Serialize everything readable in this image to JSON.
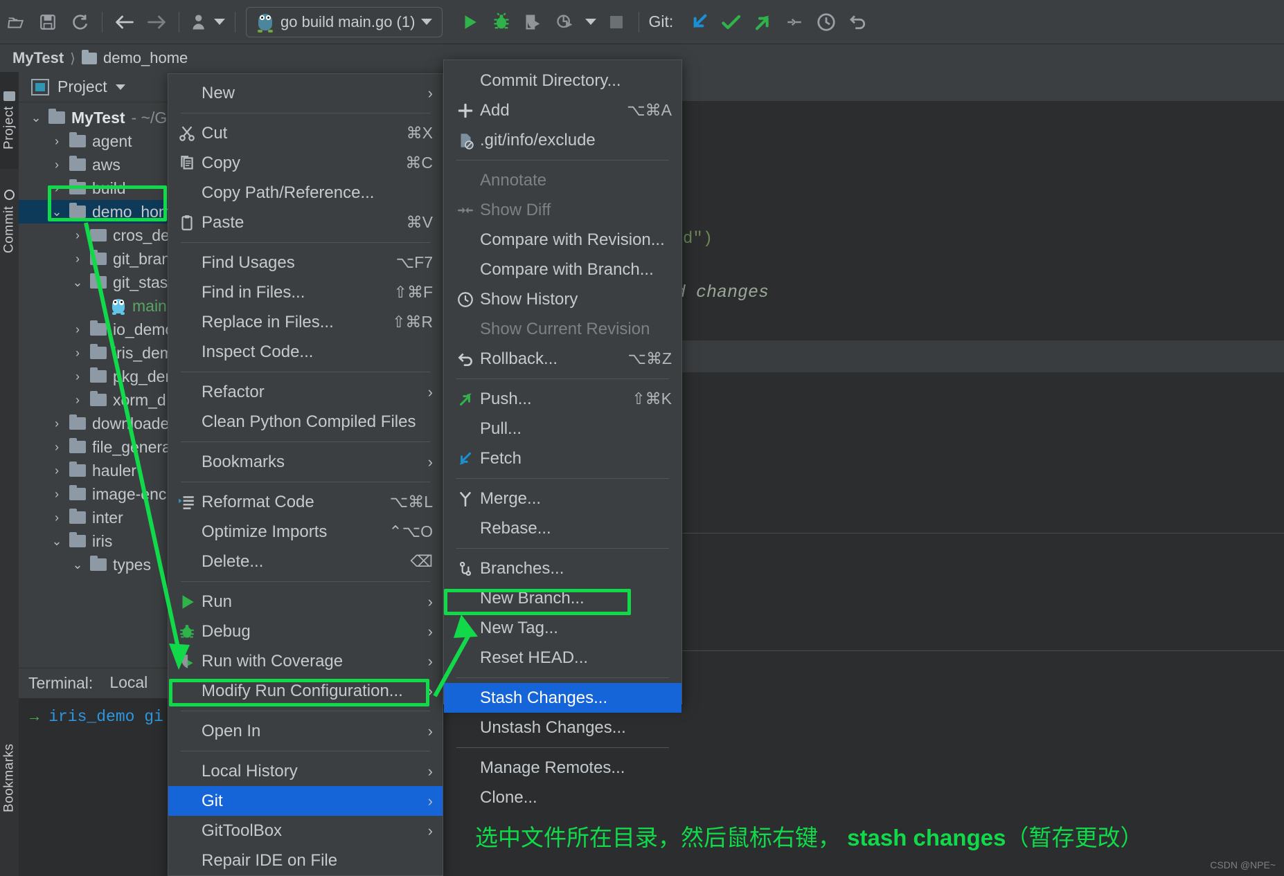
{
  "toolbar": {
    "icons": [
      "open-folder-icon",
      "save-icon",
      "sync-icon",
      "back-arrow-icon",
      "forward-arrow-icon",
      "profiler-icon"
    ],
    "run_config": "go build main.go (1)",
    "run_label": "Run",
    "debug_label": "Debug",
    "coverage_label": "Run with Coverage",
    "profile_label": "Profile",
    "stop_label": "Stop",
    "git_label": "Git:",
    "git_update_label": "Update Project",
    "git_commit_label": "Commit",
    "git_push_label": "Push",
    "git_rebase_label": "Rebase",
    "history_label": "Recent Files",
    "undo_label": "Undo"
  },
  "breadcrumb": {
    "project": "MyTest",
    "folder": "demo_home"
  },
  "tool_strips": {
    "project_tab": "Project",
    "commit_tab": "Commit",
    "bookmarks_tab": "Bookmarks"
  },
  "project_panel": {
    "title": "Project",
    "tree": [
      {
        "label": "MyTest",
        "suffix": "- ~/G",
        "depth": 0,
        "chev": "v",
        "bold": true,
        "kind": "folder"
      },
      {
        "label": "agent",
        "depth": 1,
        "chev": ">",
        "kind": "folder"
      },
      {
        "label": "aws",
        "depth": 1,
        "chev": ">",
        "kind": "folder"
      },
      {
        "label": "build",
        "depth": 1,
        "chev": ">",
        "kind": "folder"
      },
      {
        "label": "demo_hom",
        "depth": 1,
        "chev": "v",
        "kind": "folder",
        "selected": true
      },
      {
        "label": "cros_de",
        "depth": 2,
        "chev": ">",
        "kind": "folder-plain"
      },
      {
        "label": "git_bran",
        "depth": 2,
        "chev": ">",
        "kind": "folder"
      },
      {
        "label": "git_stas",
        "depth": 2,
        "chev": "v",
        "kind": "folder"
      },
      {
        "label": "main",
        "depth": 3,
        "chev": "",
        "kind": "gofile"
      },
      {
        "label": "io_demo",
        "depth": 2,
        "chev": ">",
        "kind": "folder"
      },
      {
        "label": "iris_dem",
        "depth": 2,
        "chev": ">",
        "kind": "folder"
      },
      {
        "label": "pkg_der",
        "depth": 2,
        "chev": ">",
        "kind": "folder"
      },
      {
        "label": "xorm_d",
        "depth": 2,
        "chev": ">",
        "kind": "folder"
      },
      {
        "label": "downloade",
        "depth": 1,
        "chev": ">",
        "kind": "folder"
      },
      {
        "label": "file_genera",
        "depth": 1,
        "chev": ">",
        "kind": "folder"
      },
      {
        "label": "hauler",
        "depth": 1,
        "chev": ">",
        "kind": "folder"
      },
      {
        "label": "image-enc",
        "depth": 1,
        "chev": ">",
        "kind": "folder"
      },
      {
        "label": "inter",
        "depth": 1,
        "chev": ">",
        "kind": "folder"
      },
      {
        "label": "iris",
        "depth": 1,
        "chev": "v",
        "kind": "folder"
      },
      {
        "label": "types",
        "depth": 2,
        "chev": "v",
        "kind": "folder"
      }
    ]
  },
  "terminal": {
    "title": "Terminal:",
    "tab": "Local",
    "prompt": "→",
    "command": "iris_demo gi"
  },
  "editor": {
    "code_fragment": "d\")",
    "status_fragment": "d changes"
  },
  "context_menu": {
    "items": [
      {
        "label": "New",
        "icon": "",
        "shortcut": "",
        "arrow": true
      },
      {
        "sep": true
      },
      {
        "label": "Cut",
        "icon": "scissors-icon",
        "shortcut": "⌘X"
      },
      {
        "label": "Copy",
        "icon": "copy-icon",
        "shortcut": "⌘C"
      },
      {
        "label": "Copy Path/Reference...",
        "icon": "",
        "shortcut": ""
      },
      {
        "label": "Paste",
        "icon": "paste-icon",
        "shortcut": "⌘V"
      },
      {
        "sep": true
      },
      {
        "label": "Find Usages",
        "icon": "",
        "shortcut": "⌥F7"
      },
      {
        "label": "Find in Files...",
        "icon": "",
        "shortcut": "⇧⌘F"
      },
      {
        "label": "Replace in Files...",
        "icon": "",
        "shortcut": "⇧⌘R"
      },
      {
        "label": "Inspect Code...",
        "icon": "",
        "shortcut": ""
      },
      {
        "sep": true
      },
      {
        "label": "Refactor",
        "icon": "",
        "shortcut": "",
        "arrow": true
      },
      {
        "label": "Clean Python Compiled Files",
        "icon": "",
        "shortcut": ""
      },
      {
        "sep": true
      },
      {
        "label": "Bookmarks",
        "icon": "",
        "shortcut": "",
        "arrow": true
      },
      {
        "sep": true
      },
      {
        "label": "Reformat Code",
        "icon": "reformat-icon",
        "shortcut": "⌥⌘L"
      },
      {
        "label": "Optimize Imports",
        "icon": "",
        "shortcut": "⌃⌥O"
      },
      {
        "label": "Delete...",
        "icon": "",
        "shortcut": "⌫"
      },
      {
        "sep": true
      },
      {
        "label": "Run",
        "icon": "run-icon",
        "shortcut": "",
        "arrow": true
      },
      {
        "label": "Debug",
        "icon": "debug-icon",
        "shortcut": "",
        "arrow": true
      },
      {
        "label": "Run with Coverage",
        "icon": "coverage-icon",
        "shortcut": "",
        "arrow": true
      },
      {
        "label": "Modify Run Configuration...",
        "icon": "",
        "shortcut": "",
        "arrow": true
      },
      {
        "sep": true
      },
      {
        "label": "Open In",
        "icon": "",
        "shortcut": "",
        "arrow": true
      },
      {
        "sep": true
      },
      {
        "label": "Local History",
        "icon": "",
        "shortcut": "",
        "arrow": true
      },
      {
        "label": "Git",
        "icon": "",
        "shortcut": "",
        "arrow": true,
        "highlighted": true
      },
      {
        "label": "GitToolBox",
        "icon": "",
        "shortcut": "",
        "arrow": true
      },
      {
        "label": "Repair IDE on File",
        "icon": "",
        "shortcut": ""
      }
    ]
  },
  "git_submenu": {
    "items": [
      {
        "label": "Commit Directory...",
        "icon": "",
        "shortcut": ""
      },
      {
        "label": "Add",
        "icon": "plus-icon",
        "shortcut": "⌥⌘A"
      },
      {
        "label": ".git/info/exclude",
        "icon": "exclude-icon",
        "shortcut": ""
      },
      {
        "sep": true
      },
      {
        "label": "Annotate",
        "icon": "",
        "shortcut": "",
        "disabled": true
      },
      {
        "label": "Show Diff",
        "icon": "show-diff-icon",
        "shortcut": "",
        "disabled": true
      },
      {
        "label": "Compare with Revision...",
        "icon": "",
        "shortcut": ""
      },
      {
        "label": "Compare with Branch...",
        "icon": "",
        "shortcut": ""
      },
      {
        "label": "Show History",
        "icon": "clock-icon",
        "shortcut": ""
      },
      {
        "label": "Show Current Revision",
        "icon": "",
        "shortcut": "",
        "disabled": true
      },
      {
        "label": "Rollback...",
        "icon": "rollback-icon",
        "shortcut": "⌥⌘Z"
      },
      {
        "sep": true
      },
      {
        "label": "Push...",
        "icon": "push-icon",
        "shortcut": "⇧⌘K"
      },
      {
        "label": "Pull...",
        "icon": "",
        "shortcut": ""
      },
      {
        "label": "Fetch",
        "icon": "fetch-icon",
        "shortcut": ""
      },
      {
        "sep": true
      },
      {
        "label": "Merge...",
        "icon": "merge-icon",
        "shortcut": ""
      },
      {
        "label": "Rebase...",
        "icon": "",
        "shortcut": ""
      },
      {
        "sep": true
      },
      {
        "label": "Branches...",
        "icon": "branch-icon",
        "shortcut": ""
      },
      {
        "label": "New Branch...",
        "icon": "",
        "shortcut": ""
      },
      {
        "label": "New Tag...",
        "icon": "",
        "shortcut": ""
      },
      {
        "label": "Reset HEAD...",
        "icon": "",
        "shortcut": ""
      },
      {
        "sep": true
      },
      {
        "label": "Stash Changes...",
        "icon": "",
        "shortcut": "",
        "highlighted": true
      },
      {
        "label": "Unstash Changes...",
        "icon": "",
        "shortcut": ""
      },
      {
        "sep": true
      },
      {
        "label": "Manage Remotes...",
        "icon": "",
        "shortcut": ""
      },
      {
        "label": "Clone...",
        "icon": "",
        "shortcut": ""
      }
    ]
  },
  "annotation": {
    "text_prefix": "选中文件所在目录，然后鼠标右键， ",
    "text_bold": "stash changes",
    "text_suffix": "（暂存更改）",
    "color": "#12d94a",
    "watermark": "CSDN @NPE~"
  }
}
